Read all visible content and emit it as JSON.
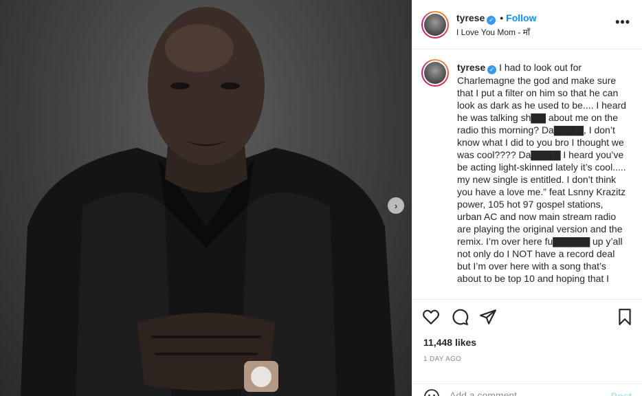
{
  "post": {
    "username": "tyrese",
    "verified_mark": "✓",
    "dot": "•",
    "follow_label": "Follow",
    "song": "I Love You Mom - माँ",
    "more_icon": "more-horizontal-icon",
    "next_icon": "chevron-right-icon",
    "caption": "I had to look out for Charlemagne the god and make sure that I put a filter on him so that he can look as dark as he used to be.... I heard he was talking sh▇▇ about me on the radio this morning? Da▇▇▇▇, I don’t know what I did to you bro I thought we was cool???? Da▇▇▇▇ I heard you’ve be acting light-skinned lately it’s cool..... my new single is entitled. I don’t think you have a love me.” feat Lsnny Krazitz power, 105 hot 97 gospel stations, urban AC and now main stream radio are playing the original version and the remix. I’m over here fu▇▇▇▇▇ up y’all not only do I NOT have a record deal but I’m over here with a song that’s about to be top 10 and hoping that I",
    "likes": "11,448 likes",
    "time": "1 DAY AGO",
    "comment_placeholder": "Add a comment...",
    "post_label": "Post",
    "icons": [
      "heart-icon",
      "comment-icon",
      "share-icon",
      "bookmark-icon",
      "emoji-icon"
    ],
    "colors": {
      "follow": "#0095f6",
      "verified": "#3897f0",
      "post_disabled": "#b2dffc"
    }
  }
}
